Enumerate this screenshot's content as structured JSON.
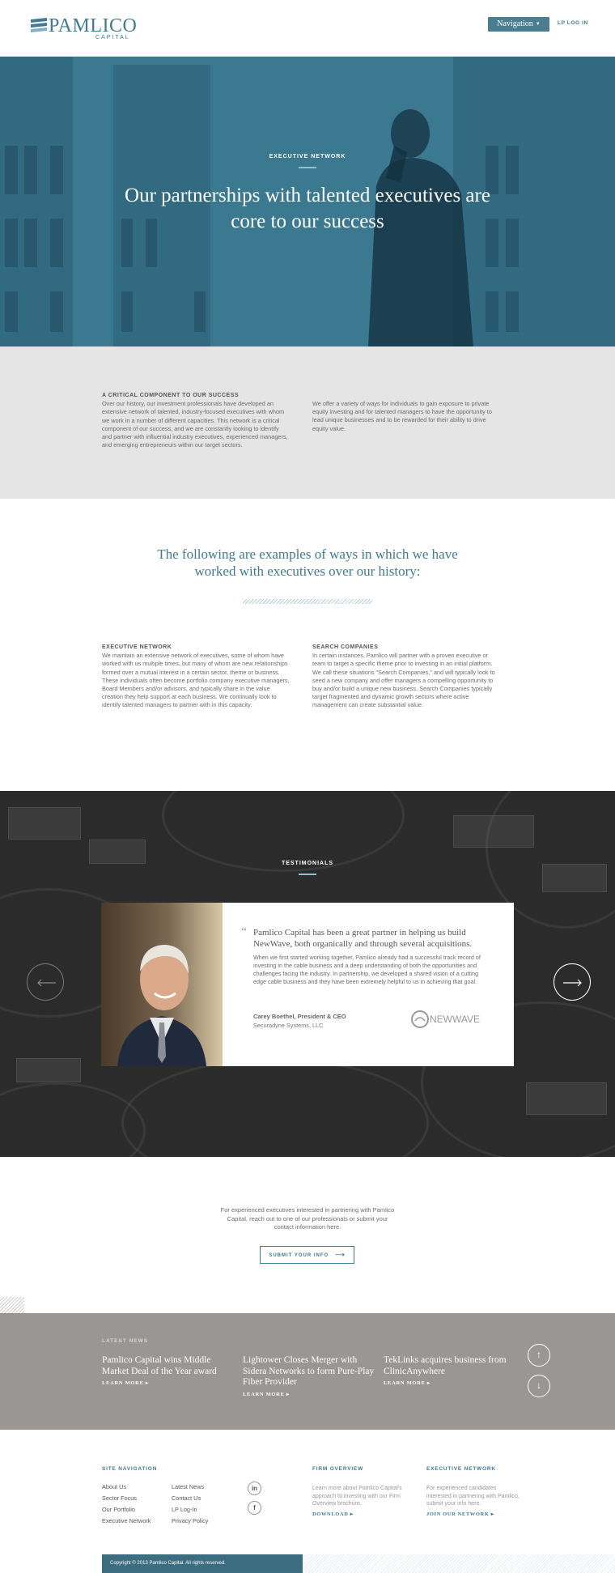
{
  "header": {
    "logo_name": "PAMLICO",
    "logo_sub": "CAPITAL",
    "nav_button": "Navigation",
    "lp_login": "LP LOG IN"
  },
  "hero": {
    "eyebrow": "EXECUTIVE NETWORK",
    "title": "Our partnerships with talented executives are core to our success"
  },
  "intro": {
    "left_heading": "A CRITICAL COMPONENT TO OUR SUCCESS",
    "left_body": "Over our history, our investment professionals have developed an extensive network of talented, industry-focused executives with whom we work in a number of different capacities. This network is a critical component of our success, and we are constantly looking to identify and partner with influential industry executives, experienced managers, and emerging entrepreneurs within our target sectors.",
    "right_body": "We offer a variety of ways for individuals to gain exposure to private equity investing and for talented managers to have the opportunity to lead unique businesses and to be rewarded for their ability to drive equity value."
  },
  "examples": {
    "title": "The following are examples of ways in which we have worked with executives over our history:",
    "left_heading": "EXECUTIVE NETWORK",
    "left_body": "We maintain an extensive network of executives, some of whom have worked with us multiple times, but many of whom are new relationships formed over a mutual interest in a certain sector, theme or business. These individuals often become portfolio company executive managers, Board Members and/or advisors, and typically share in the value creation they help support at each business. We continually look to identify talented managers to partner with in this capacity.",
    "right_heading": "SEARCH COMPANIES",
    "right_body": "In certain instances, Pamlico will partner with a proven executive or team to target a specific theme prior to investing in an initial platform. We call these situations \"Search Companies,\" and will typically look to seed a new company and offer managers a compelling opportunity to buy and/or build a unique new business. Search Companies typically target fragmented and dynamic growth sectors where active management can create substantial value."
  },
  "testimonials": {
    "label": "TESTIMONIALS",
    "quote_mark": "“",
    "quote": "Pamlico Capital has been a great partner in helping us build NewWave, both organically and through several acquisitions.",
    "body": "When we first started working together, Pamlico already had a successful track record of investing in the cable business and a deep understanding of both the opportunities and challenges facing the industry. In partnership, we developed a shared vision of a cutting edge cable business and they have been extremely helpful to us in achieving that goal.",
    "name": "Carey Boethel, President & CEO",
    "company": "Securadyne Systems, LLC",
    "company_logo": "NEWWAVE"
  },
  "cta": {
    "text": "For experienced executives interested in partnering with Pamlico Capital, reach out to one of our professionals or submit your contact information here.",
    "button": "SUBMIT YOUR INFO"
  },
  "news": {
    "label": "LATEST NEWS",
    "items": [
      {
        "title": "Pamlico Capital wins Middle Market Deal of the Year award",
        "more": "LEARN MORE"
      },
      {
        "title": "Lightower Closes Merger with Sidera Networks to form Pure-Play Fiber Provider",
        "more": "LEARN MORE"
      },
      {
        "title": "TekLinks acquires business from ClinicAnywhere",
        "more": "LEARN MORE"
      }
    ],
    "up_icon": "arrow-up-icon",
    "down_icon": "arrow-down-icon"
  },
  "footer": {
    "site_nav_heading": "SITE NAVIGATION",
    "links_col1": [
      "About Us",
      "Sector Focus",
      "Our Portfolio",
      "Executive Network"
    ],
    "links_col2": [
      "Latest News",
      "Contact Us",
      "LP Log-In",
      "Privacy Policy"
    ],
    "social": [
      "in",
      "f"
    ],
    "firm_heading": "FIRM OVERVIEW",
    "firm_text": "Learn more about Pamlico Capital's approach to investing with our Firm Overview brochure.",
    "firm_cta": "DOWNLOAD",
    "exec_heading": "EXECUTIVE NETWORK",
    "exec_text": "For experienced candidates interested in partnering with Pamlico, submit your info here.",
    "exec_cta": "JOIN OUR NETWORK",
    "copyright": "Copyright © 2013 Pamlico Capital. All rights reserved."
  },
  "colors": {
    "brand": "#3f7b93",
    "hero_bg": "#3b7991",
    "news_bg": "#9a9693",
    "intro_bg": "#e6e5e5"
  }
}
